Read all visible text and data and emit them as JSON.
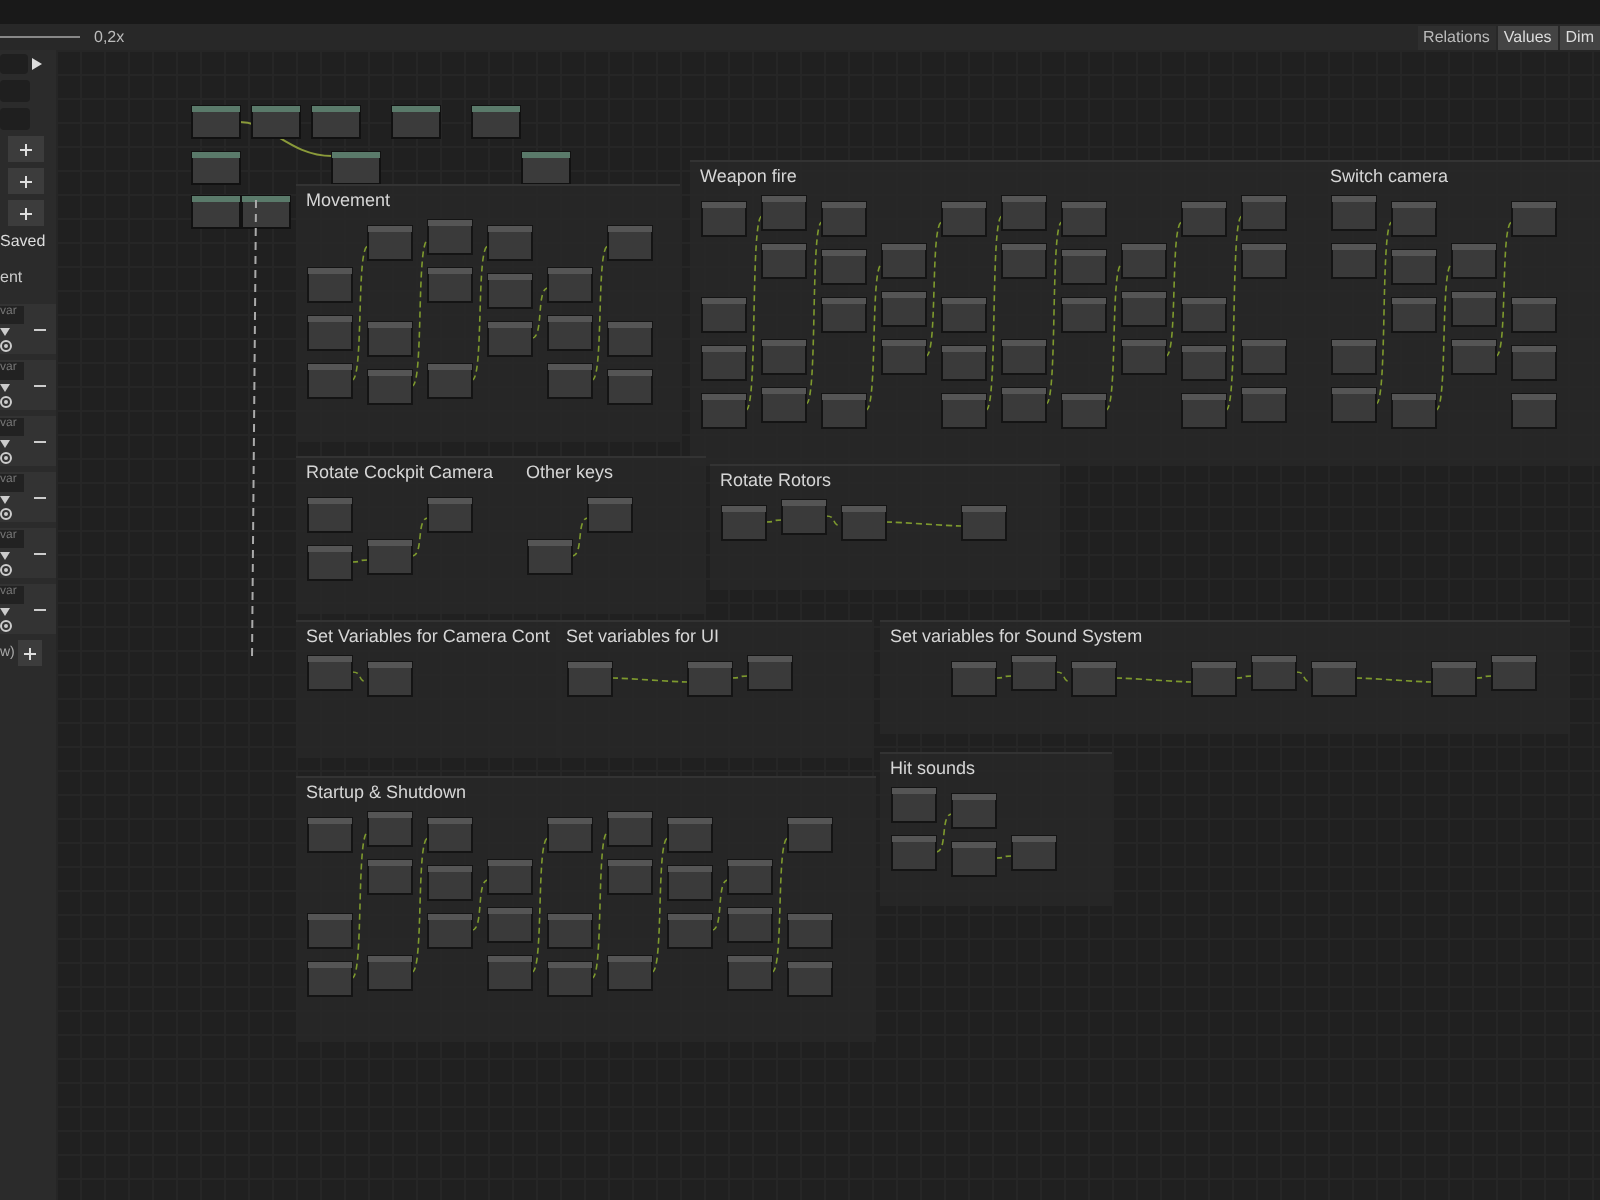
{
  "toolbar": {
    "zoom": "0,2x"
  },
  "view_toggles": [
    {
      "label": "Relations",
      "on": false
    },
    {
      "label": "Values",
      "on": true
    },
    {
      "label": "Dim",
      "on": true
    }
  ],
  "sidebar": {
    "status": "Saved",
    "section_label": "ent",
    "footer_label": "w)"
  },
  "variables": [
    {
      "name": "var"
    },
    {
      "name": "var"
    },
    {
      "name": "var"
    },
    {
      "name": "var"
    },
    {
      "name": "var"
    },
    {
      "name": "var"
    }
  ],
  "groups": [
    {
      "title": "Movement"
    },
    {
      "title": "Weapon fire"
    },
    {
      "title": "Switch camera"
    },
    {
      "title": "Rotate Cockpit Camera"
    },
    {
      "title": "Other keys"
    },
    {
      "title": "Rotate Rotors"
    },
    {
      "title": "Set Variables for Camera Cont"
    },
    {
      "title": "Set variables for UI"
    },
    {
      "title": "Set variables for Sound System"
    },
    {
      "title": "Startup & Shutdown"
    },
    {
      "title": "Hit sounds"
    }
  ]
}
